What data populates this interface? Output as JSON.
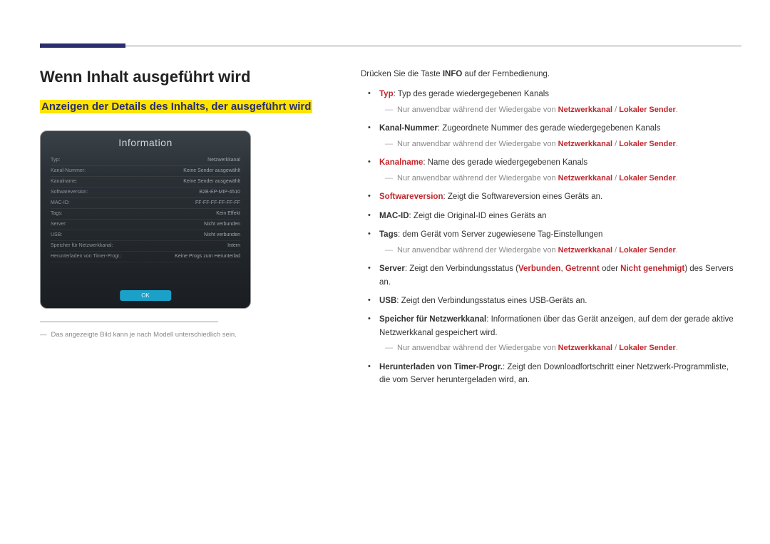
{
  "heading": "Wenn Inhalt ausgeführt wird",
  "subheading": "Anzeigen der Details des Inhalts, der ausgeführt wird",
  "screenshot": {
    "title": "Information",
    "rows": [
      {
        "label": "Typ:",
        "value": "Netzwerkkanal"
      },
      {
        "label": "Kanal-Nummer:",
        "value": "Keine Sender ausgewählt"
      },
      {
        "label": "Kanalname:",
        "value": "Keine Sender ausgewählt"
      },
      {
        "label": "Softwareversion:",
        "value": "B2B-EP-MIP-4510"
      },
      {
        "label": "MAC-ID:",
        "value": "FF-FF-FF-FF-FF-FF"
      },
      {
        "label": "Tags:",
        "value": "Kein Effekt"
      },
      {
        "label": "Server:",
        "value": "Nicht verbunden"
      },
      {
        "label": "USB:",
        "value": "Nicht verbunden"
      },
      {
        "label": "Speicher für Netzwerkkanal:",
        "value": "Intern"
      },
      {
        "label": "Herunterladen von Timer-Progr.:",
        "value": "Keine Progs zum Herunterlad"
      }
    ],
    "ok": "OK"
  },
  "footnote_dash": "―",
  "footnote": "Das angezeigte Bild kann je nach Modell unterschiedlich sein.",
  "intro_pre": "Drücken Sie die Taste ",
  "intro_bold": "INFO",
  "intro_post": " auf der Fernbedienung.",
  "note_prefix": "―",
  "note_text_pre": "Nur anwendbar während der Wiedergabe von ",
  "note_nk": "Netzwerkkanal",
  "note_sep": " / ",
  "note_ls": "Lokaler Sender",
  "note_dot": ".",
  "items": {
    "typ_label": "Typ",
    "typ_text": ": Typ des gerade wiedergegebenen Kanals",
    "kanalnummer_label": "Kanal-Nummer",
    "kanalnummer_text": ": Zugeordnete Nummer des gerade wiedergegebenen Kanals",
    "kanalname_label": "Kanalname",
    "kanalname_text": ": Name des gerade wiedergegebenen Kanals",
    "software_label": "Softwareversion",
    "software_text": ": Zeigt die Softwareversion eines Geräts an.",
    "macid_label": "MAC-ID",
    "macid_text": ": Zeigt die Original-ID eines Geräts an",
    "tags_label": "Tags",
    "tags_text": ": dem Gerät vom Server zugewiesene Tag-Einstellungen",
    "server_label": "Server",
    "server_pre": ": Zeigt den Verbindungsstatus (",
    "server_v": "Verbunden",
    "server_c": ", ",
    "server_g": "Getrennt",
    "server_or": " oder ",
    "server_n": "Nicht genehmigt",
    "server_post": ") des Servers an.",
    "usb_label": "USB",
    "usb_text": ": Zeigt den Verbindungsstatus eines USB-Geräts an.",
    "speicher_label": "Speicher für Netzwerkkanal",
    "speicher_text": ": Informationen über das Gerät anzeigen, auf dem der gerade aktive Netzwerkkanal gespeichert wird.",
    "herunter_label": "Herunterladen von Timer-Progr.",
    "herunter_text": ": Zeigt den Downloadfortschritt einer Netzwerk-Programmliste, die vom Server heruntergeladen wird, an."
  }
}
